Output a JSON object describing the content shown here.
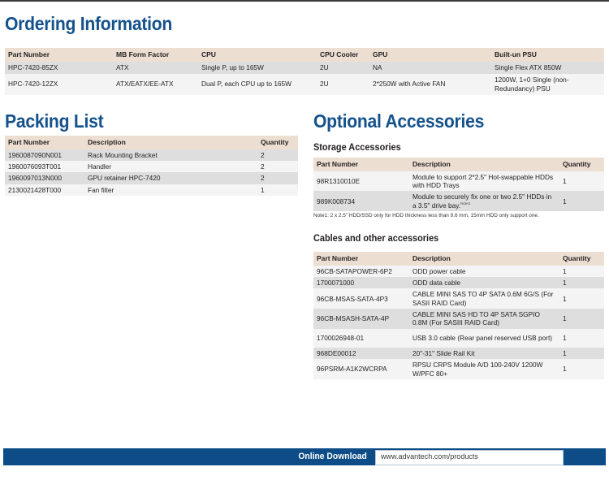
{
  "sections": {
    "ordering": {
      "title": "Ordering Information",
      "headers": [
        "Part Number",
        "MB Form Factor",
        "CPU",
        "CPU Cooler",
        "GPU",
        "Built-un PSU"
      ],
      "rows": [
        {
          "part_number": "HPC-7420-85ZX",
          "mb_form_factor": "ATX",
          "cpu": "Single P, up to 165W",
          "cpu_cooler": "2U",
          "gpu": "NA",
          "psu": "Single Flex ATX 850W"
        },
        {
          "part_number": "HPC-7420-12ZX",
          "mb_form_factor": "ATX/EATX/EE-ATX",
          "cpu": "Dual P, each CPU up to 165W",
          "cpu_cooler": "2U",
          "gpu": "2*250W with Active FAN",
          "psu": "1200W, 1+0 Single (non-Redundancy) PSU"
        }
      ]
    },
    "packing": {
      "title": "Packing List",
      "headers": [
        "Part Number",
        "Description",
        "Quantity"
      ],
      "rows": [
        {
          "part_number": "1960087090N001",
          "description": "Rack Mounting Bracket",
          "quantity": "2"
        },
        {
          "part_number": "1960076093T001",
          "description": "Handler",
          "quantity": "2"
        },
        {
          "part_number": "1960097013N000",
          "description": "GPU retainer HPC-7420",
          "quantity": "2"
        },
        {
          "part_number": "2130021428T000",
          "description": "Fan filter",
          "quantity": "1"
        }
      ]
    },
    "optional": {
      "title": "Optional Accessories",
      "storage": {
        "subtitle": "Storage Accessories",
        "headers": [
          "Part Number",
          "Description",
          "Quantity"
        ],
        "rows": [
          {
            "part_number": "98R1310010E",
            "description": "Module to support 2*2.5\" Hot-swappable HDDs with HDD Trays",
            "note_marker": "",
            "quantity": "1"
          },
          {
            "part_number": "989K008734",
            "description": "Module to securely fix one or two 2.5\" HDDs in a 3.5\" drive bay.",
            "note_marker": "Note1",
            "quantity": "1"
          }
        ],
        "note": "Note1: 2 x 2.5\" HDD/SSD only for HDD thickness less than 9.6 mm, 15mm HDD only support one."
      },
      "cables": {
        "subtitle": "Cables and other accessories",
        "headers": [
          "Part Number",
          "Description",
          "Quantity"
        ],
        "rows": [
          {
            "part_number": "96CB-SATAPOWER-6P2",
            "description": "ODD power cable",
            "quantity": "1"
          },
          {
            "part_number": "1700071000",
            "description": "ODD data cable",
            "quantity": "1"
          },
          {
            "part_number": "96CB-MSAS-SATA-4P3",
            "description": "CABLE MINI SAS TO 4P SATA 0.6M 6G/S (For SASII RAID Card)",
            "quantity": "1"
          },
          {
            "part_number": "96CB-MSASH-SATA-4P",
            "description": "CABLE MINI SAS HD TO 4P SATA SGPIO 0.8M (For SASIII RAID Card)",
            "quantity": "1"
          },
          {
            "part_number": "1700026948-01",
            "description": "USB 3.0 cable (Rear panel reserved USB port)",
            "quantity": "1"
          },
          {
            "part_number": "968DE00012",
            "description": "20\"-31\" Slide Rail Kit",
            "quantity": "1"
          },
          {
            "part_number": "96PSRM-A1K2WCRPA",
            "description": "RPSU CRPS Module A/D 100-240V 1200W W/PFC 80+",
            "quantity": "1"
          }
        ]
      }
    }
  },
  "footer": {
    "label": "Online Download",
    "url": "www.advantech.com/products"
  },
  "colors": {
    "heading_blue": "#15528c",
    "table_header_bg": "#ecdfd2",
    "row_gray": "#dedede",
    "row_light": "#f4f4f4",
    "footer_bar": "#0d4c86"
  }
}
